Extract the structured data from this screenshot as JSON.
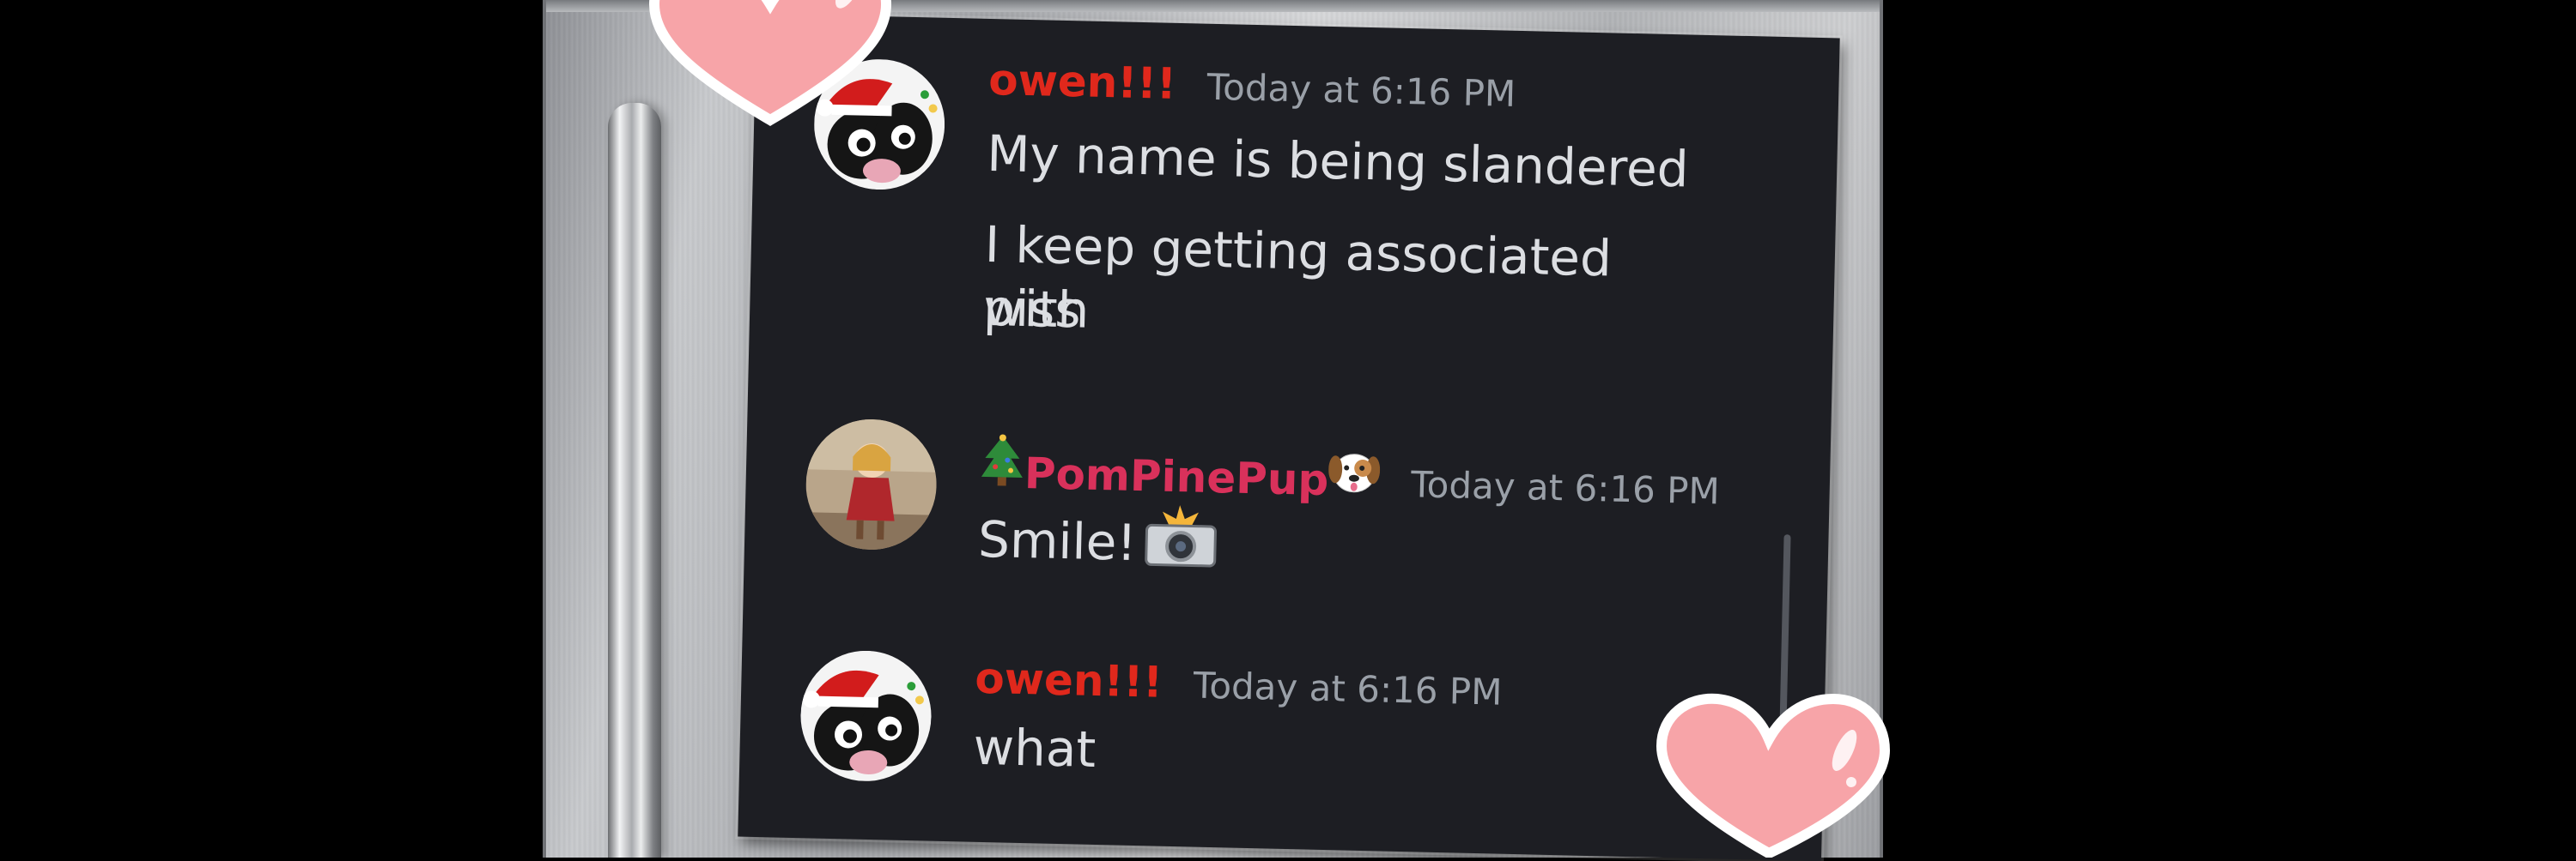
{
  "messages": [
    {
      "username": "owen!!!",
      "timestamp": "Today at 6:16 PM",
      "lines": [
        "My name is being slandered",
        "I keep getting associated with",
        "piss"
      ]
    },
    {
      "username": "PomPinePup",
      "timestamp": "Today at 6:16 PM",
      "lines": [
        "Smile!"
      ],
      "prefix_emoji": "christmas-tree-icon",
      "suffix_emoji": "dog-face-icon",
      "inline_emoji": "camera-flash-icon"
    },
    {
      "username": "owen!!!",
      "timestamp": "Today at 6:16 PM",
      "lines": [
        "what"
      ]
    }
  ],
  "colors": {
    "chat_background": "#1d1e23",
    "owen_name": "#e0281c",
    "pompinepup_name": "#d9315b",
    "timestamp": "#9aa0a8",
    "message_text": "#dcdee2",
    "heart": "#f7a4a8"
  }
}
